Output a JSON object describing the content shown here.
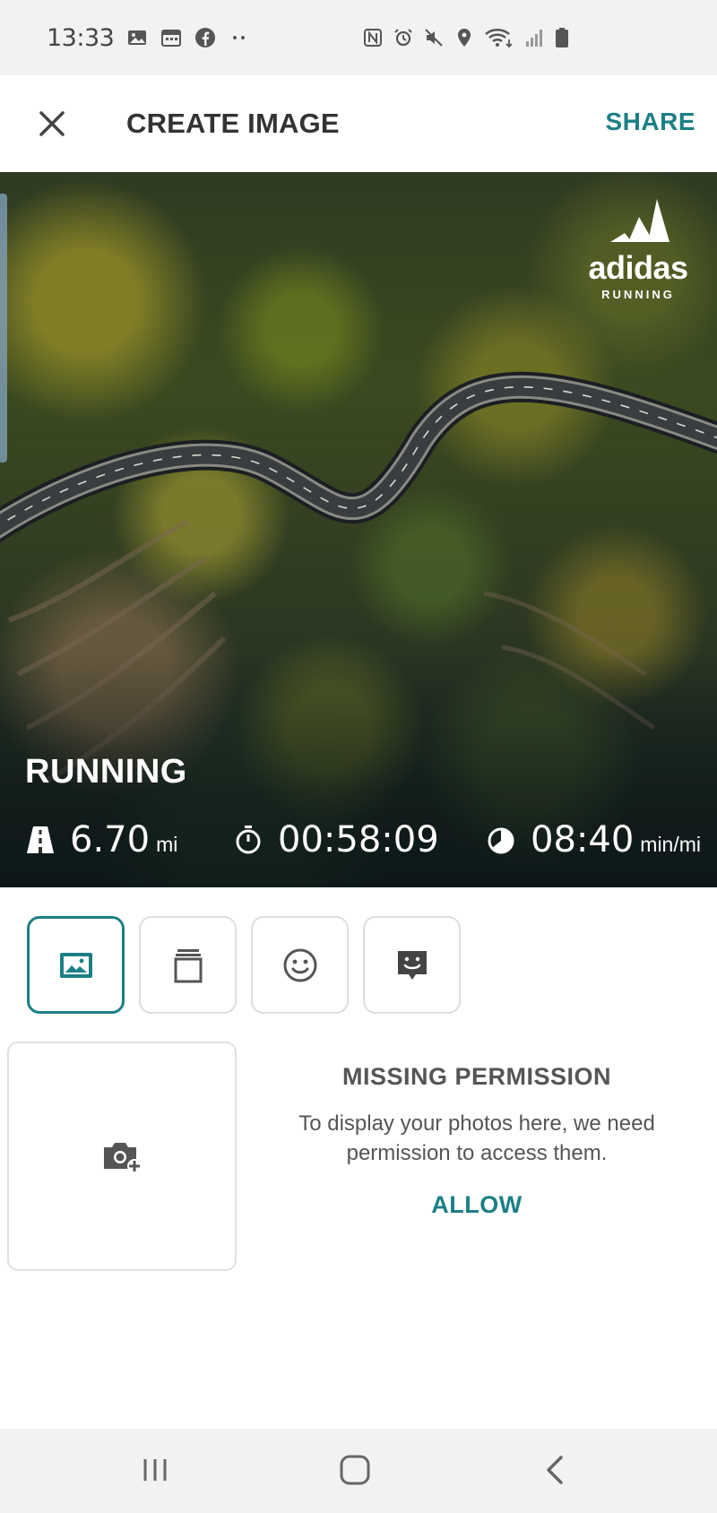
{
  "status_bar": {
    "time": "13:33",
    "left_icons": [
      "gallery-notification-icon",
      "calendar-notification-icon",
      "facebook-icon",
      "more-dots-icon"
    ],
    "right_icons": [
      "nfc-icon",
      "alarm-icon",
      "mute-icon",
      "location-icon",
      "wifi-icon",
      "signal-icon",
      "battery-icon"
    ]
  },
  "app_bar": {
    "title": "CREATE IMAGE",
    "share_label": "SHARE"
  },
  "hero": {
    "brand_name": "adidas",
    "brand_sub": "RUNNING",
    "activity": "RUNNING",
    "stats": {
      "distance_value": "6.70",
      "distance_unit": "mi",
      "duration_value": "00:58:09",
      "pace_value": "08:40",
      "pace_unit": "min/mi"
    }
  },
  "tools": {
    "items": [
      "image-icon",
      "layers-icon",
      "smiley-icon",
      "sticker-icon"
    ],
    "active_index": 0
  },
  "permission": {
    "title": "MISSING PERMISSION",
    "line1": "To display your photos here, we need",
    "line2": "permission to access them.",
    "allow_label": "ALLOW"
  },
  "colors": {
    "accent": "#1c7f86",
    "status_bar_bg": "#f2f2f2",
    "text_dark": "#333333"
  }
}
